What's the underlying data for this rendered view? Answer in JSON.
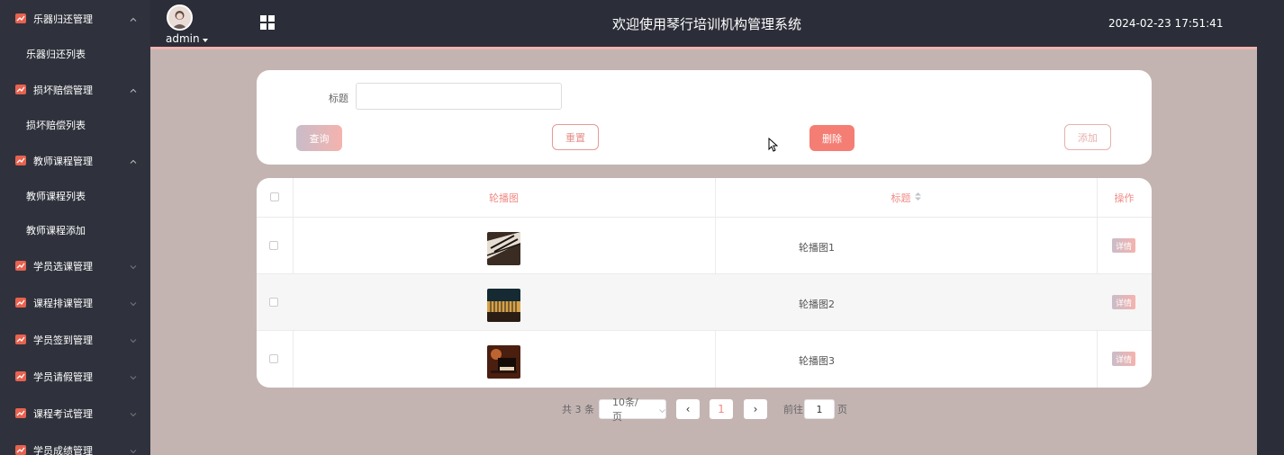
{
  "sidebar": {
    "groups": [
      {
        "label": "乐器归还管理",
        "expanded": true,
        "children": [
          "乐器归还列表"
        ]
      },
      {
        "label": "损坏赔偿管理",
        "expanded": true,
        "children": [
          "损坏赔偿列表"
        ]
      },
      {
        "label": "教师课程管理",
        "expanded": true,
        "children": [
          "教师课程列表",
          "教师课程添加"
        ]
      },
      {
        "label": "学员选课管理",
        "expanded": false
      },
      {
        "label": "课程排课管理",
        "expanded": false
      },
      {
        "label": "学员签到管理",
        "expanded": false
      },
      {
        "label": "学员请假管理",
        "expanded": false
      },
      {
        "label": "课程考试管理",
        "expanded": false
      },
      {
        "label": "学员成绩管理",
        "expanded": false
      }
    ]
  },
  "header": {
    "user": "admin",
    "title": "欢迎使用琴行培训机构管理系统",
    "datetime": "2024-02-23 17:51:41"
  },
  "search": {
    "title_label": "标题",
    "title_value": "",
    "query": "查询",
    "reset": "重置",
    "delete": "删除",
    "add": "添加"
  },
  "table": {
    "columns": {
      "image": "轮播图",
      "title": "标题",
      "actions": "操作"
    },
    "rows": [
      {
        "title": "轮播图1",
        "action": "详情"
      },
      {
        "title": "轮播图2",
        "action": "详情"
      },
      {
        "title": "轮播图3",
        "action": "详情"
      }
    ]
  },
  "pagination": {
    "total": "共 3 条",
    "page_size": "10条/页",
    "prev": "‹",
    "current": "1",
    "next": "›",
    "goto_label": "前往",
    "goto_value": "1",
    "page_suffix": "页"
  },
  "colors": {
    "accent": "#f47e74",
    "sidebar_bg": "#2f323c",
    "content_bg": "#c3b4b2",
    "icon_red": "#e8624f"
  }
}
